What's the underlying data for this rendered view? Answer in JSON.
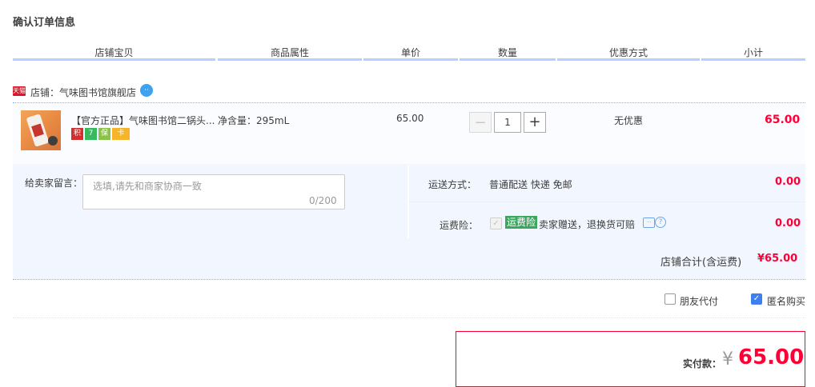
{
  "page_title": "确认订单信息",
  "table_headers": [
    "店铺宝贝",
    "商品属性",
    "单价",
    "数量",
    "优惠方式",
    "小计"
  ],
  "shop": {
    "icon_text": "天猫",
    "name": "店铺：气味图书馆旗舰店"
  },
  "item": {
    "title": "【官方正品】气味图书馆二锅头...",
    "badges": [
      "积",
      "7",
      "保",
      "卡"
    ],
    "attribute": "净含量：295mL",
    "unit_price": "65.00",
    "quantity": "1",
    "minus": "−",
    "plus": "+",
    "promotion": "无优惠",
    "subtotal": "65.00"
  },
  "memo": {
    "label": "给卖家留言：",
    "placeholder": "选填,请先和商家协商一致",
    "counter": "0/200"
  },
  "shipping": {
    "label": "运送方式：",
    "value": "普通配送 快递 免邮",
    "fee": "0.00"
  },
  "insurance": {
    "label": "运费险：",
    "badge": "运费险",
    "text": "卖家赠送，退换货可赔",
    "fee": "0.00"
  },
  "shop_total": {
    "label": "店铺合计(含运费)",
    "value": "¥65.00"
  },
  "options": {
    "friend_pay": "朋友代付",
    "anonymous": "匿名购买",
    "anonymous_checked": true
  },
  "payment": {
    "label": "实付款：",
    "currency": "¥",
    "amount": "65.00"
  },
  "colors": {
    "accent_red": "#ff0036",
    "header_line": "#b2d1ff",
    "panel_bg": "#f2f7ff",
    "checkbox_blue": "#3d7ff0"
  }
}
